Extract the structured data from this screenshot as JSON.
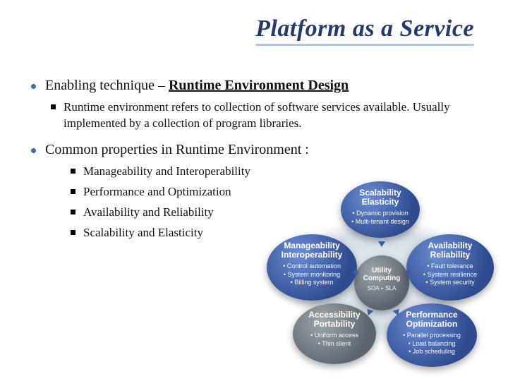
{
  "title": "Platform as a Service",
  "bullets": {
    "b1_prefix": "Enabling technique – ",
    "b1_bold": "Runtime Environment Design",
    "b1_sub1": "Runtime environment refers to collection of software services available. Usually implemented by a collection of program libraries.",
    "b2": "Common properties in Runtime Environment :",
    "b2_items": {
      "i1": "Manageability and Interoperability",
      "i2": "Performance and Optimization",
      "i3": "Availability and Reliability",
      "i4": "Scalability and Elasticity"
    }
  },
  "diagram": {
    "center": {
      "label": "Utility Computing",
      "sub": "SOA + SLA"
    },
    "top": {
      "label": "Scalability Elasticity",
      "pts": [
        "Dynamic provision",
        "Multi-tenant design"
      ]
    },
    "left": {
      "label": "Manageability Interoperability",
      "pts": [
        "Control automation",
        "System monitoring",
        "Billing system"
      ]
    },
    "right": {
      "label": "Availability Reliability",
      "pts": [
        "Fault tolerance",
        "System resilience",
        "System security"
      ]
    },
    "bl": {
      "label": "Accessibility Portability",
      "pts": [
        "Uniform access",
        "Thin client"
      ]
    },
    "br": {
      "label": "Performance Optimization",
      "pts": [
        "Parallel processing",
        "Load balancing",
        "Job scheduling"
      ]
    }
  }
}
